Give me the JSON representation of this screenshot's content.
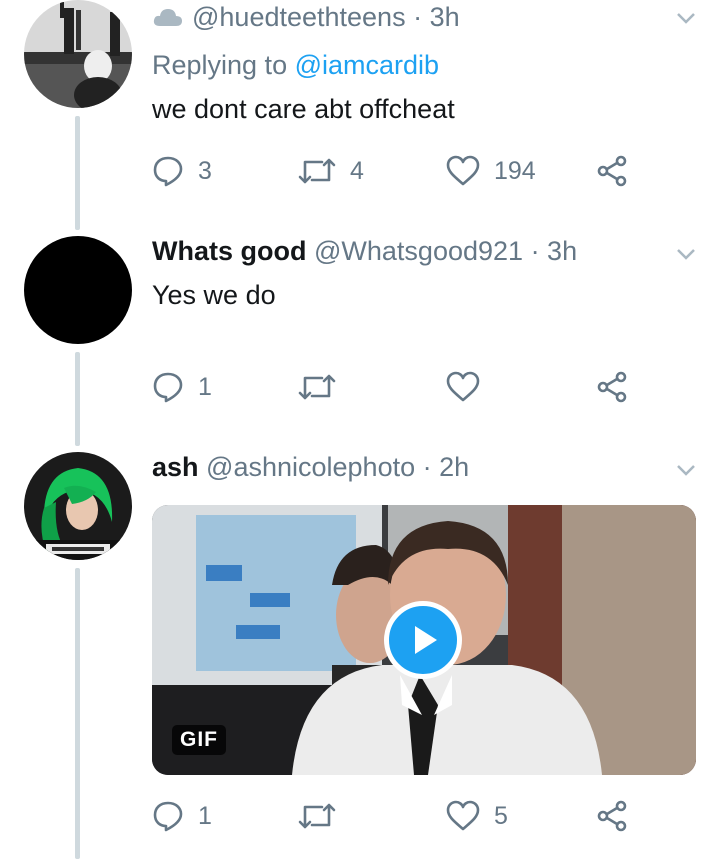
{
  "tweets": [
    {
      "cloud_icon": "cloud-icon",
      "handle": "@huedteethteens",
      "time": "· 3h",
      "replying_prefix": "Replying to",
      "replying_mention": "@iamcardib",
      "text": "we dont care abt offcheat",
      "replies": "3",
      "retweets": "4",
      "likes": "194"
    },
    {
      "name": "Whats good",
      "handle": "@Whatsgood921",
      "time": "· 3h",
      "text": "Yes we do",
      "replies": "1",
      "retweets": "",
      "likes": ""
    },
    {
      "name": "ash",
      "handle": "@ashnicolephoto",
      "time": "· 2h",
      "media_badge": "GIF",
      "replies": "1",
      "retweets": "",
      "likes": "5"
    }
  ],
  "colors": {
    "accent": "#1da1f2",
    "muted": "#657786",
    "line": "#cfd9de"
  }
}
